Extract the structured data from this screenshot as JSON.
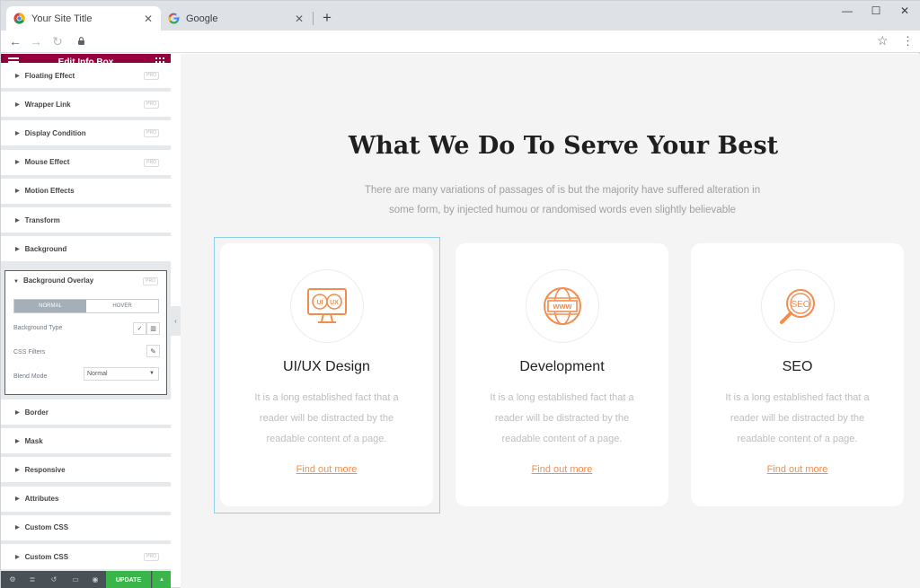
{
  "browser": {
    "tabs": [
      {
        "title": "Your Site Title",
        "active": true,
        "close_glyph": "✕"
      },
      {
        "title": "Google",
        "active": false,
        "close_glyph": "✕"
      }
    ],
    "new_tab_glyph": "+",
    "window_controls": {
      "minimize": "—",
      "maximize": "☐",
      "close": "✕"
    },
    "nav": {
      "back": "←",
      "forward": "→",
      "reload": "↻"
    },
    "star_glyph": "☆",
    "menu_glyph": "⋮"
  },
  "editor": {
    "title": "Edit Info Box",
    "sections_top": [
      {
        "label": "Floating Effect",
        "pro": "PRO"
      },
      {
        "label": "Wrapper Link",
        "pro": "PRO"
      },
      {
        "label": "Display Condition",
        "pro": "PRO"
      },
      {
        "label": "Mouse Effect",
        "pro": "PRO"
      },
      {
        "label": "Motion Effects",
        "pro": ""
      },
      {
        "label": "Transform",
        "pro": ""
      },
      {
        "label": "Background",
        "pro": ""
      }
    ],
    "overlay": {
      "label": "Background Overlay",
      "pro": "PRO",
      "tabs": [
        "NORMAL",
        "HOVER"
      ],
      "active_tab": "NORMAL",
      "background_type_label": "Background Type",
      "css_filters_label": "CSS Filters",
      "blend_mode_label": "Blend Mode",
      "blend_mode_value": "Normal"
    },
    "sections_bottom": [
      {
        "label": "Border",
        "pro": ""
      },
      {
        "label": "Mask",
        "pro": ""
      },
      {
        "label": "Responsive",
        "pro": ""
      },
      {
        "label": "Attributes",
        "pro": ""
      },
      {
        "label": "Custom CSS",
        "pro": ""
      },
      {
        "label": "Custom CSS",
        "pro": "PRO"
      }
    ],
    "footer": {
      "update_label": "UPDATE",
      "icons": [
        "gear-icon",
        "layers-icon",
        "history-icon",
        "responsive-icon",
        "eye-icon"
      ]
    },
    "collapse_glyph": "‹"
  },
  "page": {
    "heading": "What We Do To Serve Your Best",
    "subtext": "There are many variations of passages of is but the majority have suffered alteration in some form, by injected humou or randomised words even slightly believable",
    "accent_color": "#f28d4f",
    "cards": [
      {
        "title": "UI/UX Design",
        "desc": "It is a long established fact that a reader will be distracted by the readable content of a page.",
        "link": "Find out more",
        "icon": "uiux-monitor-icon",
        "icon_text": "UI|UX"
      },
      {
        "title": "Development",
        "desc": "It is a long established fact that a reader will be distracted by the readable content of a page.",
        "link": "Find out more",
        "icon": "www-globe-icon",
        "icon_text": "www"
      },
      {
        "title": "SEO",
        "desc": "It is a long established fact that a reader will be distracted by the readable content of a page.",
        "link": "Find out more",
        "icon": "seo-magnifier-icon",
        "icon_text": "SEO"
      }
    ]
  }
}
